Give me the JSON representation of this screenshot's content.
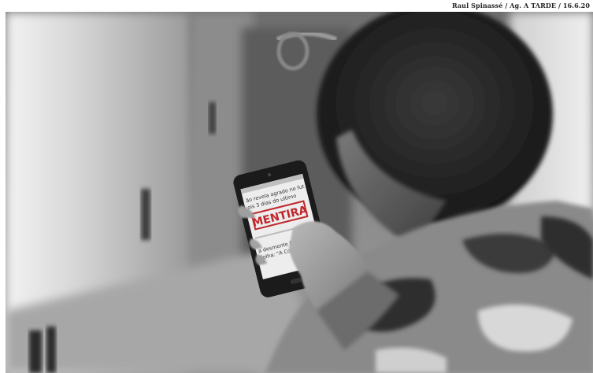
{
  "caption": {
    "credit": "Raul Spinassé / Ag. A TARDE / 16.6.20"
  },
  "photo": {
    "subject": "person holding smartphone",
    "phone_screen": {
      "stamp_text": "MENTIRA",
      "stamp_color": "#c0262c",
      "lines": [
        "ão revela agrado no fut",
        "ois 3 dias do ultimo",
        "a desmente Fake News",
        "Folha: \"A Coronavír ao"
      ]
    }
  }
}
